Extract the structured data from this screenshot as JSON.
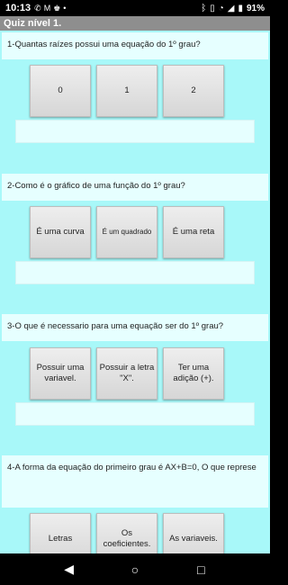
{
  "status": {
    "time": "10:13",
    "icons_left": [
      "whatsapp-icon",
      "gmail-icon",
      "game-controller-icon",
      "dot-icon"
    ],
    "battery": "91%"
  },
  "app": {
    "title": "Quiz nível 1."
  },
  "questions": [
    {
      "text": "1-Quantas raízes possui uma equação do 1º grau?",
      "options": [
        "0",
        "1",
        "2"
      ]
    },
    {
      "text": "2-Como é o gráfico de uma função do 1º grau?",
      "options": [
        "É uma curva",
        "É um quadrado",
        "É uma reta"
      ]
    },
    {
      "text": "3-O que é necessario para uma equação ser do 1º grau?",
      "options": [
        "Possuir uma variavel.",
        "Possuir a letra \"X\".",
        "Ter uma adição (+)."
      ]
    },
    {
      "text": "4-A forma da equação do primeiro grau é AX+B=0, O que represe",
      "options": [
        "Letras",
        "Os coeficientes.",
        "As variaveis."
      ]
    }
  ],
  "navigation": {
    "back": "◀",
    "home": "○",
    "recents": "□"
  }
}
